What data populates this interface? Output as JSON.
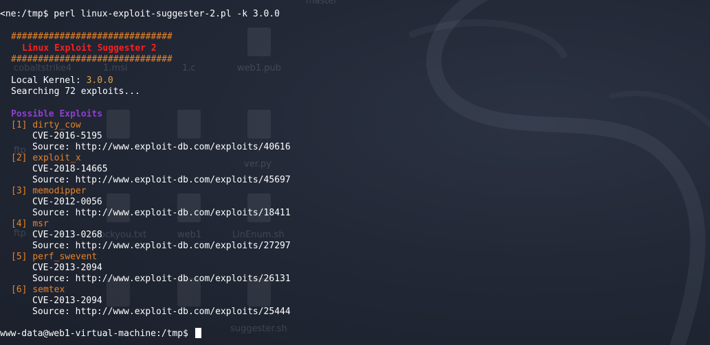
{
  "command": {
    "prompt": "<ne:/tmp$ ",
    "text": "perl linux-exploit-suggester-2.pl -k 3.0.0"
  },
  "banner": {
    "border": "##############################",
    "title": "Linux Exploit Suggester 2"
  },
  "kernel": {
    "label": "Local Kernel: ",
    "value": "3.0.0"
  },
  "searching": "Searching 72 exploits...",
  "possible_heading": "Possible Exploits",
  "exploits": [
    {
      "num": "[1]",
      "name": "dirty_cow",
      "cve": "CVE-2016-5195",
      "source": "Source: http://www.exploit-db.com/exploits/40616"
    },
    {
      "num": "[2]",
      "name": "exploit_x",
      "cve": "CVE-2018-14665",
      "source": "Source: http://www.exploit-db.com/exploits/45697"
    },
    {
      "num": "[3]",
      "name": "memodipper",
      "cve": "CVE-2012-0056",
      "source": "Source: http://www.exploit-db.com/exploits/18411"
    },
    {
      "num": "[4]",
      "name": "msr",
      "cve": "CVE-2013-0268",
      "source": "Source: http://www.exploit-db.com/exploits/27297"
    },
    {
      "num": "[5]",
      "name": "perf_swevent",
      "cve": "CVE-2013-2094",
      "source": "Source: http://www.exploit-db.com/exploits/26131"
    },
    {
      "num": "[6]",
      "name": "semtex",
      "cve": "CVE-2013-2094",
      "source": "Source: http://www.exploit-db.com/exploits/25444"
    }
  ],
  "final_prompt": "www-data@web1-virtual-machine:/tmp$ ",
  "desktop_labels": {
    "cobaltstrike": "cobaltstrike4",
    "msi": "1.msi",
    "c": "1.c",
    "web1pub": "web1.pub",
    "ftp1": "ftp",
    "ftp2": "ftp",
    "rockyou": "rockyou.txt",
    "web1": "web1",
    "linenum": "LinEnum.sh",
    "suggester": "suggester.sh",
    "ver": "ver.py",
    "master": "master"
  },
  "colors": {
    "hash_border": "#e8832a",
    "banner_title": "#ff1f1f",
    "kernel_value": "#e2a84a",
    "heading": "#8f3fd0",
    "exploit_name": "#e8832a",
    "text": "#ffffff",
    "background": "#1f2430"
  }
}
